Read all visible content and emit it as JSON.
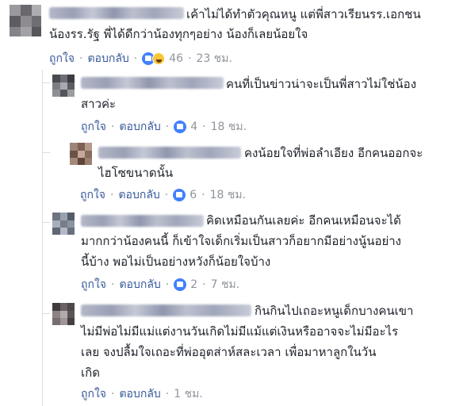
{
  "comments": [
    {
      "lines": [
        "เค้าไม่ได้ทำตัวคุณหนู แต่พี่สาวเรียนรร.เอกชน",
        "น้องรร.รัฐ พี่ได้ดีกว่าน้องทุกๆอย่าง น้องก็เลยน้อยใจ"
      ],
      "like": "ถูกใจ",
      "reply": "ตอบกลับ",
      "reactions": [
        "like-icon",
        "haha-icon"
      ],
      "count": "46",
      "time": "23 ชม."
    },
    {
      "lines": [
        "คนที่เป็นข่าวน่าจะเป็นพี่สาวไม่ใช่น้อง",
        "สาวค่ะ"
      ],
      "like": "ถูกใจ",
      "reply": "ตอบกลับ",
      "reactions": [
        "like-icon"
      ],
      "count": "4",
      "time": "18 ชม."
    },
    {
      "lines": [
        "คงน้อยใจที่พ่อลำเอียง อีกคนออกจะ",
        "ไฮโซขนาดนั้น"
      ],
      "like": "ถูกใจ",
      "reply": "ตอบกลับ",
      "reactions": [
        "like-icon"
      ],
      "count": "6",
      "time": "18 ชม."
    },
    {
      "lines": [
        "คิดเหมือนกันเลยค่ะ อีกคนเหมือนจะได้",
        "มากกว่าน้องคนนี้ ก็เข้าใจเด็กเริ่มเป็นสาวก็อยากมีอย่างนู้นอย่าง",
        "นี้บ้าง พอไม่เป็นอย่างหวังก็น้อยใจบ้าง"
      ],
      "like": "ถูกใจ",
      "reply": "ตอบกลับ",
      "reactions": [
        "like-icon"
      ],
      "count": "2",
      "time": "7 ชม."
    },
    {
      "lines": [
        "กินกินไปเถอะหนูเด็กบางคนเขา",
        "ไม่มีพ่อไม่มีแม่แต่งานวันเกิดไม่มีแม้แต่เงินหรืออาจจะไม่มีอะไร",
        "เลย จงปลื้มใจเถอะที่พ่ออุตส่าห์สละเวลา เพื่อมาหาลูกในวัน",
        "เกิด"
      ],
      "like": "ถูกใจ",
      "reply": "ตอบกลับ",
      "time": "1 ชม."
    }
  ]
}
